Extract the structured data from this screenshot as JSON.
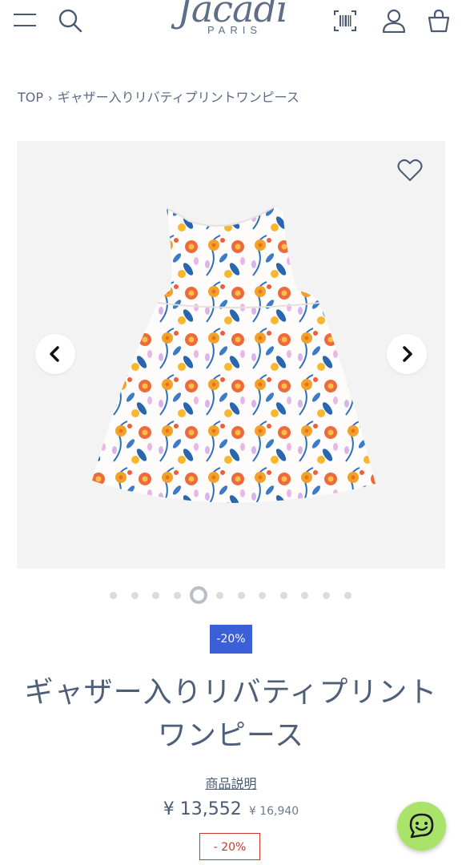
{
  "header": {
    "logo_text": "Jacadi",
    "logo_subtext": "PARIS"
  },
  "breadcrumb": {
    "home": "TOP",
    "separator": "›",
    "current": "ギャザー入りリバティプリントワンピース"
  },
  "gallery": {
    "slide_count": 12,
    "active_slide": 5
  },
  "product": {
    "discount_badge": "-20%",
    "title_line1": "ギャザー入りリバティプリント",
    "title_line2": "ワンピース",
    "description_link": "商品説明",
    "price_current": "¥ 13,552",
    "price_original": "¥ 16,940",
    "discount_label": "- 20%"
  },
  "colors": {
    "accent_blue": "#3b5fd6",
    "sale_red": "#c9372c",
    "chat_green": "#a9e36a",
    "text": "#4a5a73"
  },
  "icons": [
    "menu-icon",
    "search-icon",
    "barcode-icon",
    "account-icon",
    "cart-icon",
    "heart-icon",
    "chevron-left-icon",
    "chevron-right-icon",
    "chat-icon"
  ]
}
